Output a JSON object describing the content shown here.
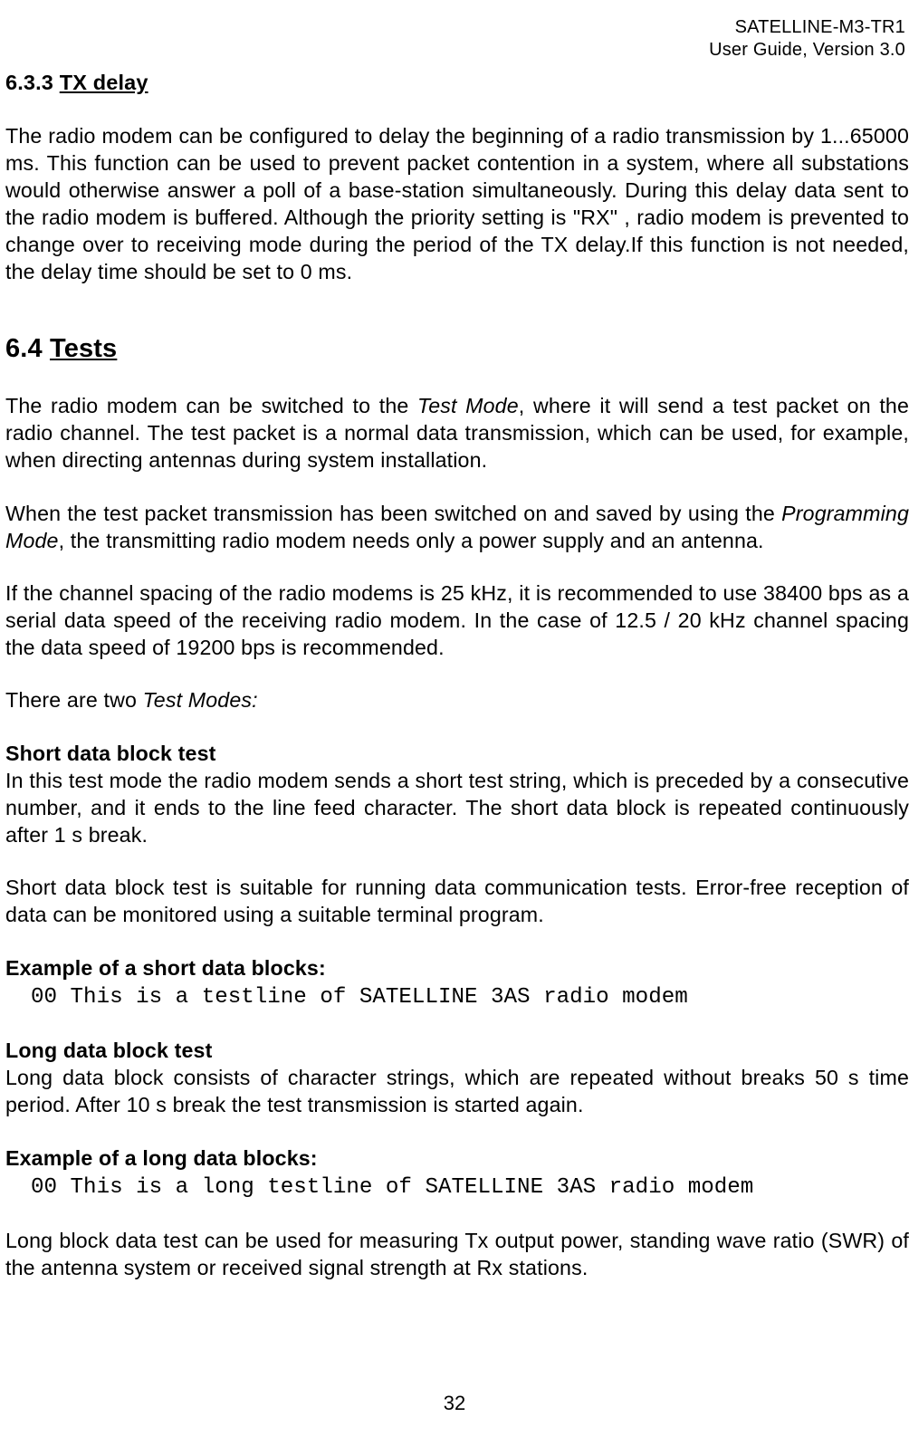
{
  "header": {
    "line1": "SATELLINE-M3-TR1",
    "line2": "User Guide, Version 3.0"
  },
  "s633": {
    "num": "6.3.3",
    "title": "TX delay",
    "p1": "The radio modem can be configured to delay the beginning of a radio transmission by 1...65000 ms. This function can be used to prevent packet contention in a system, where all substations would otherwise answer a poll of a base-station simultaneously. During this delay data sent to the radio modem is buffered. Although the priority setting is \"RX\" , radio modem is prevented to change over to receiving mode during the period of the TX delay.If this function is not needed, the delay time should be set to 0 ms."
  },
  "s64": {
    "num": "6.4",
    "title": "Tests",
    "p1a": "The radio modem can be switched to the ",
    "p1b": "Test Mode",
    "p1c": ", where it will send a test packet on the radio channel. The test packet is a normal data transmission, which can be used, for example, when directing antennas during system installation.",
    "p2a": "When the test packet transmission has been switched on and saved by using the ",
    "p2b": "Programming Mode",
    "p2c": ", the transmitting radio modem needs only a power supply and an antenna.",
    "p3": "If the channel spacing of the radio modems is 25 kHz, it is recommended to use 38400 bps as a serial data speed of the receiving radio modem. In the case of 12.5 / 20 kHz channel spacing the data speed of 19200 bps is recommended.",
    "p4a": "There are two ",
    "p4b": "Test Modes:",
    "short_h": "Short data block test",
    "short_p1": "In this test mode the radio modem sends a short test string, which is preceded by a consecutive number, and it ends to the line feed character. The short data block is repeated continuously after 1 s break.",
    "short_p2": "Short data block test is suitable for running data communication tests. Error-free reception of data can be monitored using a suitable terminal program.",
    "short_ex_h": "Example of a short data blocks:",
    "short_ex": "00 This is a testline of SATELLINE 3AS radio modem",
    "long_h": "Long data block test",
    "long_p1": "Long data block consists of character strings, which are repeated without breaks 50 s time period. After 10 s break the test transmission is started again.",
    "long_ex_h": "Example of a long data blocks:",
    "long_ex": "00 This is a long testline of SATELLINE 3AS radio modem",
    "long_p2": "Long block data test can be used for measuring Tx output power, standing wave ratio (SWR) of the antenna system or received signal strength at Rx stations."
  },
  "footer": {
    "page": "32"
  }
}
